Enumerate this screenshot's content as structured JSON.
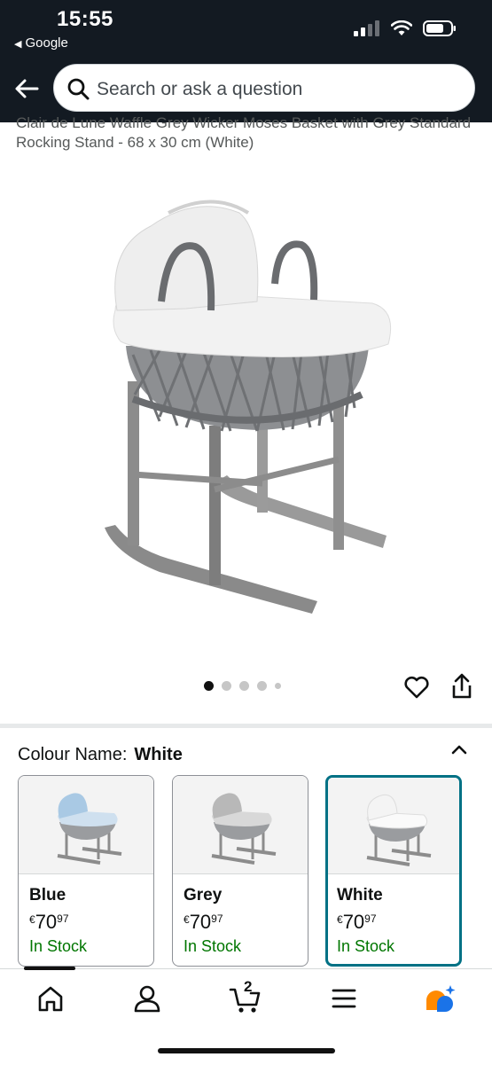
{
  "status_bar": {
    "time": "15:55",
    "back_app": "Google"
  },
  "search": {
    "placeholder": "Search or ask a question"
  },
  "product": {
    "title": "Clair de Lune Waffle Grey Wicker Moses Basket with Grey Standard Rocking Stand - 68 x 30 cm (White)",
    "image_count": 5,
    "active_image": 1
  },
  "colour": {
    "label": "Colour Name:",
    "selected": "White",
    "options": [
      {
        "name": "Blue",
        "currency": "€",
        "price_whole": "70",
        "price_fraction": "97",
        "stock": "In Stock"
      },
      {
        "name": "Grey",
        "currency": "€",
        "price_whole": "70",
        "price_fraction": "97",
        "stock": "In Stock"
      },
      {
        "name": "White",
        "currency": "€",
        "price_whole": "70",
        "price_fraction": "97",
        "stock": "In Stock"
      }
    ]
  },
  "cart": {
    "count": "2"
  },
  "colors": {
    "header_bg": "#131a22",
    "accent_teal": "#007185",
    "stock_green": "#007600"
  },
  "icons": [
    "back-arrow-icon",
    "search-icon",
    "heart-icon",
    "share-icon",
    "chevron-up-icon",
    "home-icon",
    "account-icon",
    "cart-icon",
    "menu-icon",
    "rufus-icon"
  ]
}
